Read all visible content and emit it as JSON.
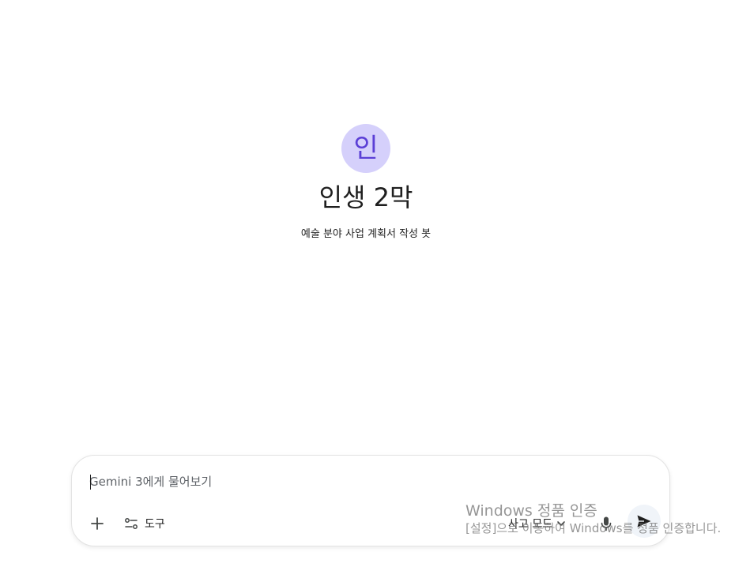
{
  "gem": {
    "avatar_letter": "인",
    "title": "인생 2막",
    "description": "예술 분야 사업 계획서 작성 봇"
  },
  "composer": {
    "placeholder": "Gemini 3에게 물어보기",
    "add_icon": "plus-icon",
    "tools_icon": "tools-icon",
    "tools_label": "도구",
    "mode_label": "사고 모드",
    "mode_icon": "chevron-down-icon",
    "mic_icon": "microphone-icon",
    "send_icon": "send-icon"
  },
  "watermark": {
    "title": "Windows 정품 인증",
    "subtitle": "[설정]으로 이동하여 Windows를 정품 인증합니다."
  }
}
